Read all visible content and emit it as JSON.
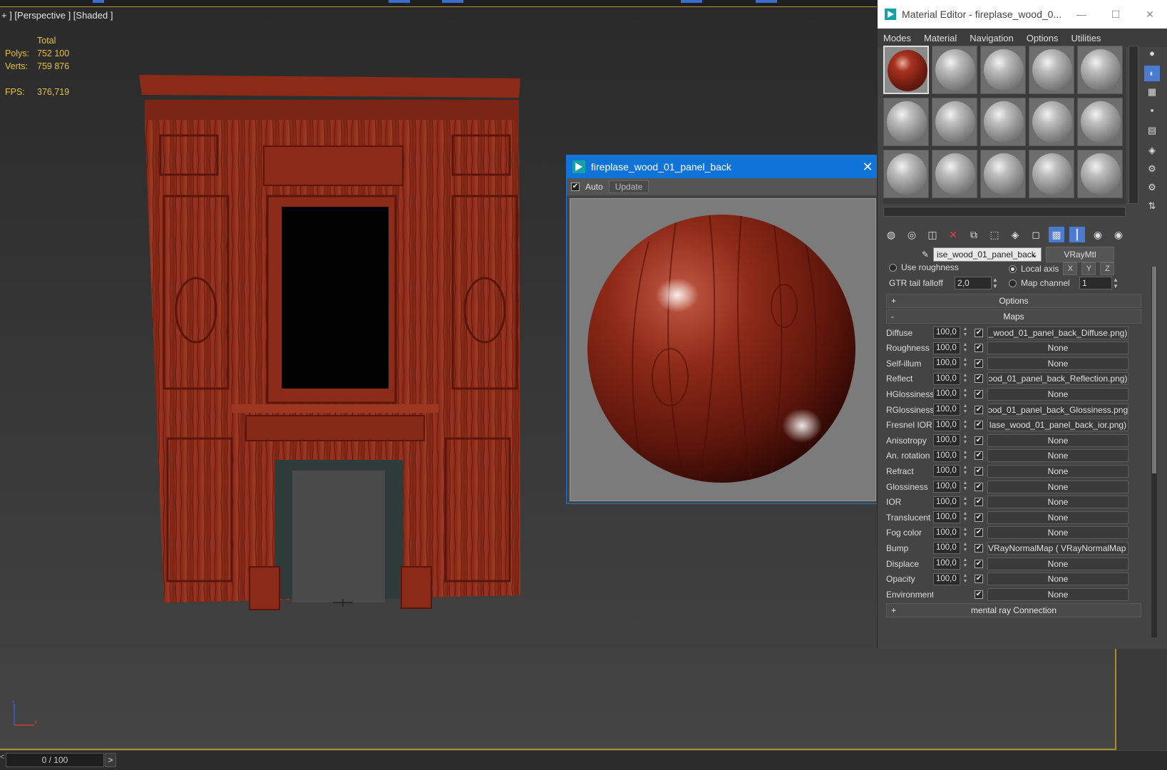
{
  "viewport": {
    "label": "+ ] [Perspective ] [Shaded ]",
    "stats": {
      "total_label": "Total",
      "polys_label": "Polys:",
      "polys_value": "752 100",
      "verts_label": "Verts:",
      "verts_value": "759 876",
      "fps_label": "FPS:",
      "fps_value": "376,719"
    },
    "gizmo": {
      "z": "z",
      "x": "x"
    }
  },
  "timeline": {
    "frame": "0 / 100",
    "prev": "<",
    "next": ">"
  },
  "preview": {
    "title": "fireplase_wood_01_panel_back",
    "auto_label": "Auto",
    "auto_checked": "✔",
    "update_label": "Update",
    "close": "✕"
  },
  "material_editor": {
    "title": "Material Editor - fireplase_wood_0...",
    "win_min": "—",
    "win_max": "☐",
    "win_close": "✕",
    "menu": [
      "Modes",
      "Material",
      "Navigation",
      "Options",
      "Utilities"
    ],
    "material_name": "ise_wood_01_panel_back",
    "material_type": "VRayMtl",
    "params": {
      "use_roughness": "Use roughness",
      "local_axis": "Local axis",
      "axis_x": "X",
      "axis_y": "Y",
      "axis_z": "Z",
      "gtr_label": "GTR tail falloff",
      "gtr_value": "2,0",
      "map_channel_label": "Map channel",
      "map_channel_value": "1"
    },
    "options_rollout": {
      "sign": "+",
      "label": "Options"
    },
    "maps_rollout": {
      "sign": "-",
      "label": "Maps"
    },
    "mental_ray": {
      "sign": "+",
      "label": "mental ray Connection"
    },
    "maps": [
      {
        "name": "Diffuse",
        "amount": "100,0",
        "map": "_wood_01_panel_back_Diffuse.png)"
      },
      {
        "name": "Roughness",
        "amount": "100,0",
        "map": "None"
      },
      {
        "name": "Self-illum",
        "amount": "100,0",
        "map": "None"
      },
      {
        "name": "Reflect",
        "amount": "100,0",
        "map": "ɔod_01_panel_back_Reflection.png)"
      },
      {
        "name": "HGlossiness",
        "amount": "100,0",
        "map": "None"
      },
      {
        "name": "RGlossiness",
        "amount": "100,0",
        "map": "ɔod_01_panel_back_Glossiness.png)"
      },
      {
        "name": "Fresnel IOR",
        "amount": "100,0",
        "map": "lase_wood_01_panel_back_ior.png)"
      },
      {
        "name": "Anisotropy",
        "amount": "100,0",
        "map": "None"
      },
      {
        "name": "An. rotation",
        "amount": "100,0",
        "map": "None"
      },
      {
        "name": "Refract",
        "amount": "100,0",
        "map": "None"
      },
      {
        "name": "Glossiness",
        "amount": "100,0",
        "map": "None"
      },
      {
        "name": "IOR",
        "amount": "100,0",
        "map": "None"
      },
      {
        "name": "Translucent",
        "amount": "100,0",
        "map": "None"
      },
      {
        "name": "Fog color",
        "amount": "100,0",
        "map": "None"
      },
      {
        "name": "Bump",
        "amount": "100,0",
        "map": "VRayNormalMap  ( VRayNormalMap )"
      },
      {
        "name": "Displace",
        "amount": "100,0",
        "map": "None"
      },
      {
        "name": "Opacity",
        "amount": "100,0",
        "map": "None"
      },
      {
        "name": "Environment",
        "amount": "",
        "map": "None"
      }
    ],
    "check": "✔"
  },
  "colors": {
    "wood_dark": "#5a150c",
    "wood_mid": "#8c2a18",
    "wood_light": "#a8402a",
    "accent_blue": "#0f73d8",
    "stats_yellow": "#e6c23a"
  }
}
